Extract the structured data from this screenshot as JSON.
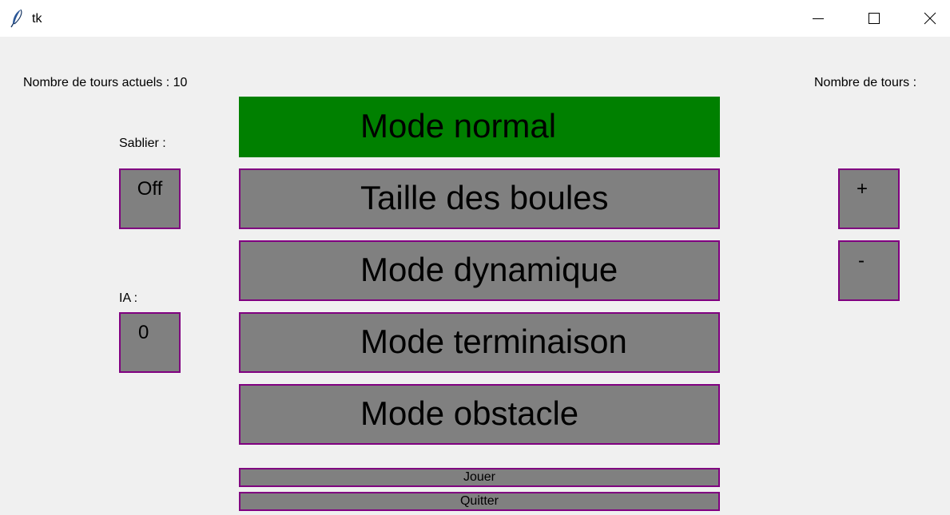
{
  "window": {
    "title": "tk",
    "icon": "feather-icon",
    "controls": [
      "minimize-icon",
      "maximize-icon",
      "close-icon"
    ]
  },
  "left": {
    "tours_actuels": "Nombre de tours actuels : 10",
    "sablier_label": "Sablier :",
    "sablier_value": "Off",
    "ia_label": "IA :",
    "ia_value": "0"
  },
  "right": {
    "tours_label": "Nombre de tours :",
    "plus": "+",
    "minus": "-"
  },
  "modes": [
    {
      "label": "Mode normal",
      "active": true
    },
    {
      "label": "Taille des boules",
      "active": false
    },
    {
      "label": "Mode dynamique",
      "active": false
    },
    {
      "label": "Mode terminaison",
      "active": false
    },
    {
      "label": "Mode obstacle",
      "active": false
    }
  ],
  "actions": {
    "play": "Jouer",
    "quit": "Quitter"
  },
  "colors": {
    "background": "#f0f0f0",
    "button_fill": "#808080",
    "button_border": "#800080",
    "active_mode": "#008000"
  }
}
